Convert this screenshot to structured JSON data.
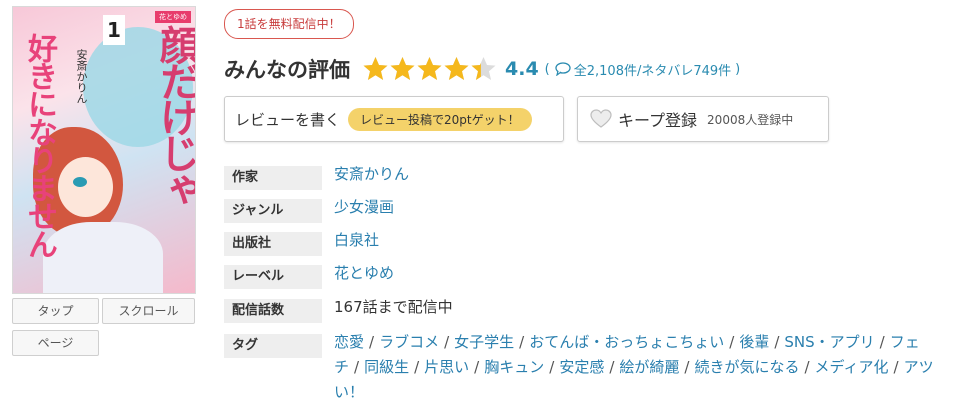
{
  "cover": {
    "title": "好きになりません顔だけじゃ",
    "title_left": "好きになりません",
    "title_right": "顔だけじゃ",
    "author": "安斎かりん",
    "volume": "1",
    "label_logo": "花とゆめ"
  },
  "view_modes": {
    "tap": "タップ",
    "scroll": "スクロール",
    "page": "ページ"
  },
  "free_badge": "1話を無料配信中！",
  "rating": {
    "title": "みんなの評価",
    "score": "4.4",
    "stars_value": 4.4,
    "stars_max": 5,
    "count_prefix": "(",
    "count_text": "全2,108件/ネタバレ749件",
    "count_suffix": ")",
    "star_color": "#f5b81c"
  },
  "review_button": {
    "label": "レビューを書く",
    "bonus": "レビュー投稿で20ptゲット！"
  },
  "keep_button": {
    "label": "キープ登録",
    "count": "20008人登録中"
  },
  "info": {
    "author_label": "作家",
    "author_value": "安斎かりん",
    "genre_label": "ジャンル",
    "genre_value": "少女漫画",
    "publisher_label": "出版社",
    "publisher_value": "白泉社",
    "label_label": "レーベル",
    "label_value": "花とゆめ",
    "episodes_label": "配信話数",
    "episodes_value": "167話まで配信中",
    "tags_label": "タグ",
    "tags": [
      "恋愛",
      "ラブコメ",
      "女子学生",
      "おてんば・おっちょこちょい",
      "後輩",
      "SNS・アプリ",
      "フェチ",
      "同級生",
      "片思い",
      "胸キュン",
      "安定感",
      "絵が綺麗",
      "続きが気になる",
      "メディア化",
      "アツい！"
    ]
  },
  "colors": {
    "link": "#2a7fae",
    "accent_red": "#c83c3c",
    "pill_yellow": "#f4d26a"
  }
}
